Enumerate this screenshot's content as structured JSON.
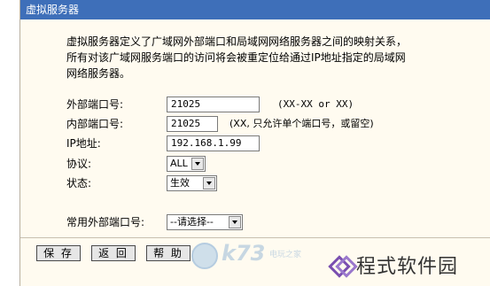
{
  "window": {
    "title": "虚拟服务器"
  },
  "description": [
    "虚拟服务器定义了广域网外部端口和局域网网络服务器之间的映射关系，",
    "所有对该广域网服务端口的访问将会被重定位给通过IP地址指定的局域网",
    "网络服务器。"
  ],
  "form": {
    "external_port": {
      "label": "外部端口号:",
      "value": "21025",
      "hint": "(XX-XX or XX)"
    },
    "internal_port": {
      "label": "内部端口号:",
      "value": "21025",
      "hint": "(XX, 只允许单个端口号，或留空)"
    },
    "ip_address": {
      "label": "IP地址:",
      "value": "192.168.1.99"
    },
    "protocol": {
      "label": "协议:",
      "value": "ALL"
    },
    "status": {
      "label": "状态:",
      "value": "生效"
    },
    "common_port": {
      "label": "常用外部端口号:",
      "value": "--请选择--"
    }
  },
  "buttons": {
    "save": "保 存",
    "back": "返 回",
    "help": "帮 助"
  },
  "watermarks": {
    "k73_text": "k73",
    "k73_sub": "电玩之家",
    "logo_text": "程式软件园"
  },
  "colors": {
    "titlebar": "#3e6fb9",
    "panel_bg": "#fffbf0"
  },
  "icons": [
    "dropdown-arrow-icon",
    "gamepad-icon",
    "diamond-logo-icon"
  ]
}
